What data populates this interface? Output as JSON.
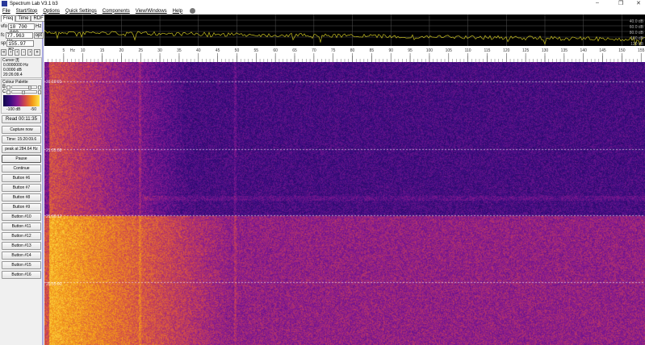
{
  "window": {
    "title": "Spectrum Lab V3.1 b3",
    "minimize": "–",
    "restore": "❐",
    "close": "✕"
  },
  "menu": [
    "File",
    "Start/Stop",
    "Options",
    "Quick Settings",
    "Components",
    "View/Windows",
    "Help"
  ],
  "tabs": [
    "Freq",
    "Time",
    "RDF"
  ],
  "freq": {
    "vfo_label": "vfo",
    "vfo_value": "10 700 000",
    "vfo_unit": "Hz",
    "fc_label": "fc",
    "fc_value": "77.963 Hz",
    "opt_label": "opt",
    "sp_label": "sp",
    "sp_value": "155.97 Hz"
  },
  "nav_buttons": [
    "«",
    "‹",
    "‹",
    "-",
    "›",
    "»"
  ],
  "cursor": {
    "title": "Cursor [f]",
    "freq": "0.0000000 Hz",
    "level": "0.0000 dB",
    "time": "20:26:09.4"
  },
  "palette": {
    "title": "Colour Palette",
    "b_label": "B",
    "c_label": "C",
    "b_value": 0.6,
    "c_value": 0.35,
    "min_label": "-100 dB",
    "max_label": "-50"
  },
  "buttons": {
    "read": "Read 00:11:35",
    "capture": "Capture now",
    "time": "Time:  15:20:09.6",
    "peak": "peak at 284.64 Hz",
    "pause": "Pause",
    "continue": "Continue",
    "custom": [
      "Button #6",
      "Button #7",
      "Button #8",
      "Button #9",
      "Button #10",
      "Button #11",
      "Button #12",
      "Button #13",
      "Button #14",
      "Button #15",
      "Button #16"
    ]
  },
  "spectrum": {
    "db_labels": [
      "40.0 dB",
      "60.0 dB",
      "80.0 dB",
      "100 dB",
      "120 dB"
    ],
    "trace_color": "#c8c020"
  },
  "freq_scale": {
    "unit": "Hz",
    "labels": [
      5,
      10,
      15,
      20,
      25,
      30,
      35,
      40,
      45,
      50,
      55,
      60,
      65,
      70,
      75,
      80,
      85,
      90,
      95,
      100,
      105,
      110,
      115,
      120,
      125,
      130,
      135,
      140,
      145,
      150,
      155
    ],
    "max_hz": 156
  },
  "waterfall": {
    "timestamps": [
      "21:10:01",
      "21:05:08",
      "21:00:17",
      "20:55:00"
    ]
  }
}
